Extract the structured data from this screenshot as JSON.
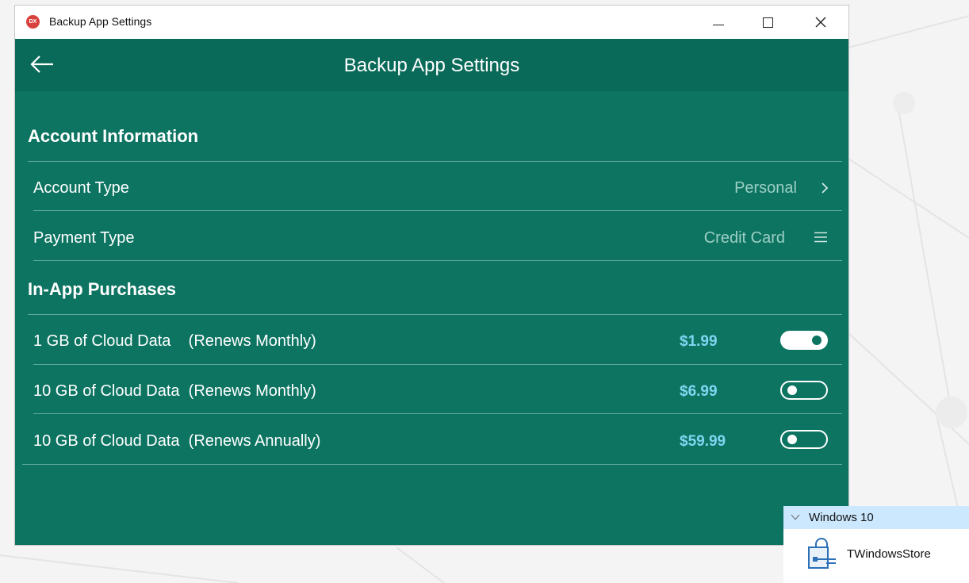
{
  "window": {
    "title": "Backup App Settings",
    "logo_text": "DX",
    "controls": [
      "minimize",
      "maximize",
      "close"
    ]
  },
  "appbar": {
    "back_icon": "arrow-left-icon",
    "title": "Backup App Settings"
  },
  "account_section": {
    "header": "Account Information",
    "rows": [
      {
        "label": "Account Type",
        "value": "Personal",
        "icon": "chevron-right-icon"
      },
      {
        "label": "Payment Type",
        "value": "Credit Card",
        "icon": "hamburger-menu-icon"
      }
    ]
  },
  "purchases_section": {
    "header": "In-App Purchases",
    "rows": [
      {
        "label": "1 GB of Cloud Data    (Renews Monthly)",
        "price": "$1.99",
        "enabled": true
      },
      {
        "label": "10 GB of Cloud Data  (Renews Monthly)",
        "price": "$6.99",
        "enabled": false
      },
      {
        "label": "10 GB of Cloud Data  (Renews Annually)",
        "price": "$59.99",
        "enabled": false
      }
    ]
  },
  "tray": {
    "group": "Windows 10",
    "item": "TWindowsStore"
  },
  "colors": {
    "window_bg": "#0d7462",
    "appbar_bg": "#0a6a59",
    "price": "#7fd6f0",
    "secondary_text": "#9ccfc4",
    "tray_header": "#cce8ff"
  }
}
